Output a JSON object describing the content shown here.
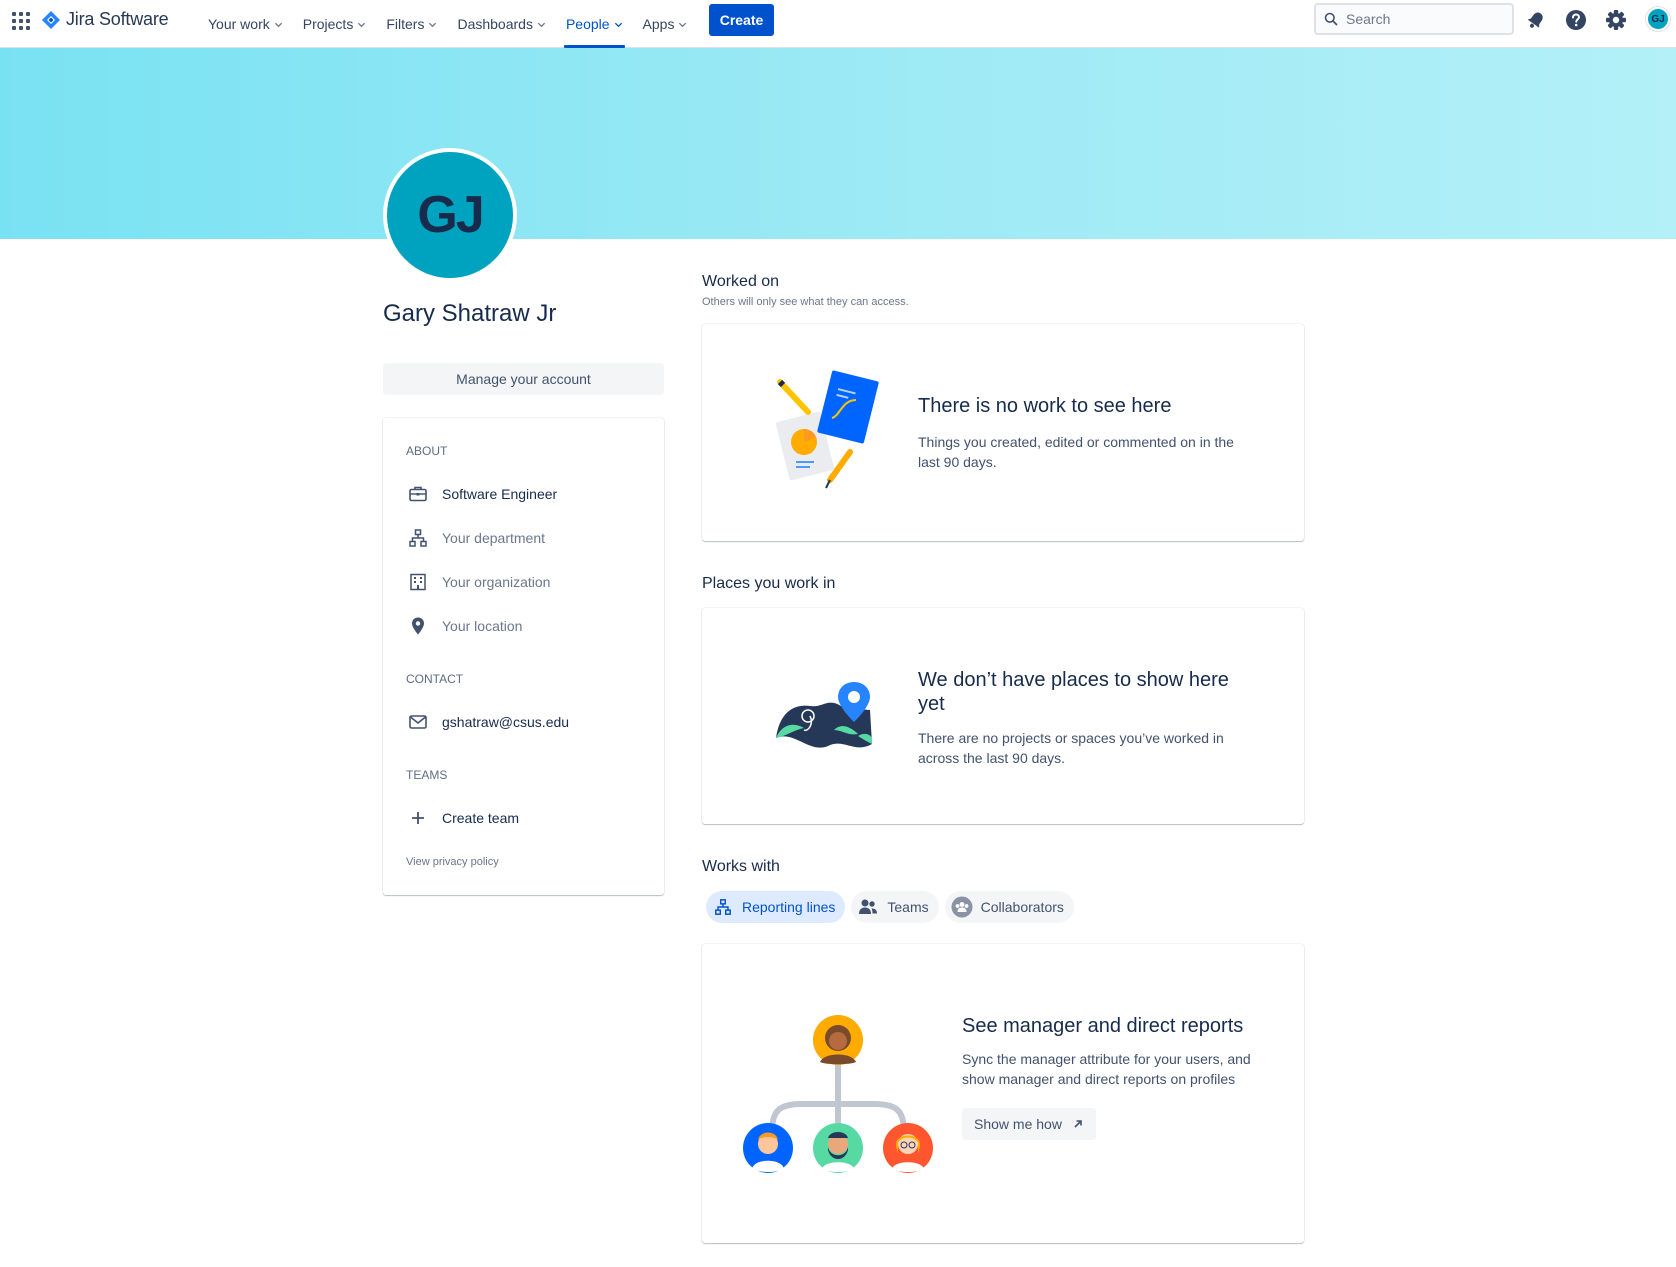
{
  "nav": {
    "product": "Jira Software",
    "items": [
      {
        "label": "Your work",
        "active": false
      },
      {
        "label": "Projects",
        "active": false
      },
      {
        "label": "Filters",
        "active": false
      },
      {
        "label": "Dashboards",
        "active": false
      },
      {
        "label": "People",
        "active": true
      },
      {
        "label": "Apps",
        "active": false
      }
    ],
    "create_label": "Create",
    "search_placeholder": "Search",
    "icons": [
      "notifications-icon",
      "help-icon",
      "settings-icon"
    ],
    "user_initials": "GJ"
  },
  "profile": {
    "initials": "GJ",
    "name": "Gary Shatraw Jr",
    "manage_label": "Manage your account",
    "about_heading": "About",
    "about": [
      {
        "icon": "briefcase-icon",
        "label": "Software Engineer",
        "placeholder": false
      },
      {
        "icon": "department-icon",
        "label": "Your department",
        "placeholder": true
      },
      {
        "icon": "organization-icon",
        "label": "Your organization",
        "placeholder": true
      },
      {
        "icon": "location-icon",
        "label": "Your location",
        "placeholder": true
      }
    ],
    "contact_heading": "Contact",
    "email": "gshatraw@csus.edu",
    "teams_heading": "Teams",
    "create_team_label": "Create team",
    "privacy_label": "View privacy policy"
  },
  "worked_on": {
    "heading": "Worked on",
    "subheading": "Others will only see what they can access.",
    "title": "There is no work to see here",
    "description": "Things you created, edited or commented on in the last 90 days."
  },
  "places": {
    "heading": "Places you work in",
    "title": "We don’t have places to show here yet",
    "description": "There are no projects or spaces you’ve worked in across the last 90 days."
  },
  "works_with": {
    "heading": "Works with",
    "tabs": [
      {
        "label": "Reporting lines",
        "active": true
      },
      {
        "label": "Teams",
        "active": false
      },
      {
        "label": "Collaborators",
        "active": false
      }
    ],
    "title": "See manager and direct reports",
    "description": "Sync the manager attribute for your users, and show manager and direct reports on profiles",
    "button_label": "Show me how"
  },
  "colors": {
    "brand_blue": "#0052cc",
    "avatar_teal": "#00a3bf",
    "banner": "#79e2f2"
  }
}
